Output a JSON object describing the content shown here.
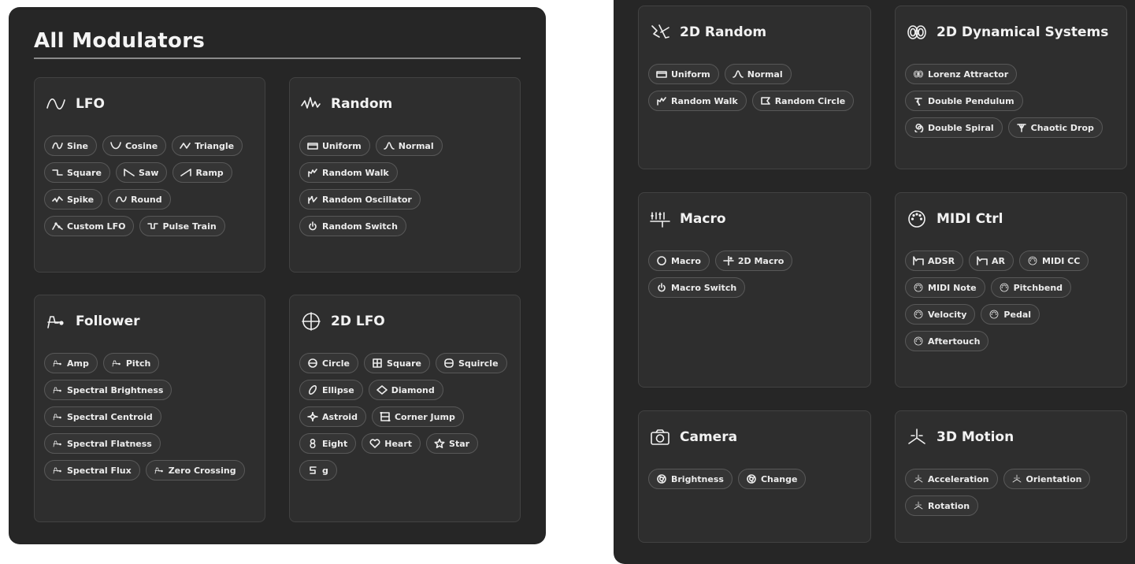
{
  "left_panel": {
    "title": "All Modulators",
    "cards": [
      {
        "id": "lfo",
        "title": "LFO",
        "icon": "sine-wave-icon",
        "chips": [
          {
            "label": "Sine",
            "icon": "sine-icon"
          },
          {
            "label": "Cosine",
            "icon": "cosine-icon"
          },
          {
            "label": "Triangle",
            "icon": "triangle-wave-icon"
          },
          {
            "label": "Square",
            "icon": "square-wave-icon"
          },
          {
            "label": "Saw",
            "icon": "saw-wave-icon"
          },
          {
            "label": "Ramp",
            "icon": "ramp-wave-icon"
          },
          {
            "label": "Spike",
            "icon": "spike-wave-icon"
          },
          {
            "label": "Round",
            "icon": "round-wave-icon"
          },
          {
            "label": "Custom LFO",
            "icon": "custom-lfo-icon"
          },
          {
            "label": "Pulse Train",
            "icon": "pulse-train-icon"
          }
        ]
      },
      {
        "id": "random",
        "title": "Random",
        "icon": "random-wave-icon",
        "chips": [
          {
            "label": "Uniform",
            "icon": "uniform-icon"
          },
          {
            "label": "Normal",
            "icon": "normal-icon"
          },
          {
            "label": "Random Walk",
            "icon": "random-walk-icon"
          },
          {
            "label": "Random Oscillator",
            "icon": "random-oscillator-icon"
          },
          {
            "label": "Random Switch",
            "icon": "power-switch-icon"
          }
        ]
      },
      {
        "id": "follower",
        "title": "Follower",
        "icon": "follower-icon",
        "chips": [
          {
            "label": "Amp",
            "icon": "follower-icon"
          },
          {
            "label": "Pitch",
            "icon": "follower-icon"
          },
          {
            "label": "Spectral Brightness",
            "icon": "follower-icon"
          },
          {
            "label": "Spectral Centroid",
            "icon": "follower-icon"
          },
          {
            "label": "Spectral Flatness",
            "icon": "follower-icon"
          },
          {
            "label": "Spectral Flux",
            "icon": "follower-icon"
          },
          {
            "label": "Zero Crossing",
            "icon": "follower-icon"
          }
        ]
      },
      {
        "id": "lfo2d",
        "title": "2D LFO",
        "icon": "crosshair-circle-icon",
        "chips": [
          {
            "label": "Circle",
            "icon": "circle-icon"
          },
          {
            "label": "Square",
            "icon": "square-shape-icon"
          },
          {
            "label": "Squircle",
            "icon": "squircle-icon"
          },
          {
            "label": "Ellipse",
            "icon": "ellipse-icon"
          },
          {
            "label": "Diamond",
            "icon": "diamond-icon"
          },
          {
            "label": "Astroid",
            "icon": "astroid-icon"
          },
          {
            "label": "Corner Jump",
            "icon": "corner-jump-icon"
          },
          {
            "label": "Eight",
            "icon": "figure-eight-icon"
          },
          {
            "label": "Heart",
            "icon": "heart-icon"
          },
          {
            "label": "Star",
            "icon": "star-icon"
          },
          {
            "label": "g",
            "icon": "g-curve-icon"
          }
        ]
      }
    ]
  },
  "right_panel": {
    "cards": [
      {
        "id": "random2d",
        "title": "2D Random",
        "icon": "random-2d-icon",
        "chips": [
          {
            "label": "Uniform",
            "icon": "uniform-icon"
          },
          {
            "label": "Normal",
            "icon": "normal-icon"
          },
          {
            "label": "Random Walk",
            "icon": "random-walk-icon"
          },
          {
            "label": "Random Circle",
            "icon": "random-circle-icon"
          }
        ]
      },
      {
        "id": "dyn2d",
        "title": "2D Dynamical Systems",
        "icon": "attractor-icon",
        "chips": [
          {
            "label": "Lorenz Attractor",
            "icon": "attractor-icon"
          },
          {
            "label": "Double Pendulum",
            "icon": "pendulum-icon"
          },
          {
            "label": "Double Spiral",
            "icon": "spiral-icon"
          },
          {
            "label": "Chaotic Drop",
            "icon": "chaotic-drop-icon"
          }
        ]
      },
      {
        "id": "macro",
        "title": "Macro",
        "icon": "macro-sliders-icon",
        "chips": [
          {
            "label": "Macro",
            "icon": "knob-circle-icon"
          },
          {
            "label": "2D Macro",
            "icon": "xy-pad-icon"
          },
          {
            "label": "Macro Switch",
            "icon": "power-switch-icon"
          }
        ]
      },
      {
        "id": "midi",
        "title": "MIDI Ctrl",
        "icon": "midi-port-icon",
        "chips": [
          {
            "label": "ADSR",
            "icon": "adsr-envelope-icon"
          },
          {
            "label": "AR",
            "icon": "adsr-envelope-icon"
          },
          {
            "label": "MIDI CC",
            "icon": "midi-port-icon"
          },
          {
            "label": "MIDI Note",
            "icon": "midi-port-icon"
          },
          {
            "label": "Pitchbend",
            "icon": "midi-port-icon"
          },
          {
            "label": "Velocity",
            "icon": "midi-port-icon"
          },
          {
            "label": "Pedal",
            "icon": "midi-port-icon"
          },
          {
            "label": "Aftertouch",
            "icon": "midi-port-icon"
          }
        ]
      },
      {
        "id": "camera",
        "title": "Camera",
        "icon": "camera-icon",
        "chips": [
          {
            "label": "Brightness",
            "icon": "aperture-icon"
          },
          {
            "label": "Change",
            "icon": "aperture-icon"
          }
        ]
      },
      {
        "id": "motion3d",
        "title": "3D Motion",
        "icon": "axes-3d-icon",
        "chips": [
          {
            "label": "Acceleration",
            "icon": "axes-3d-icon"
          },
          {
            "label": "Orientation",
            "icon": "axes-3d-icon"
          },
          {
            "label": "Rotation",
            "icon": "axes-3d-icon"
          }
        ]
      }
    ]
  }
}
